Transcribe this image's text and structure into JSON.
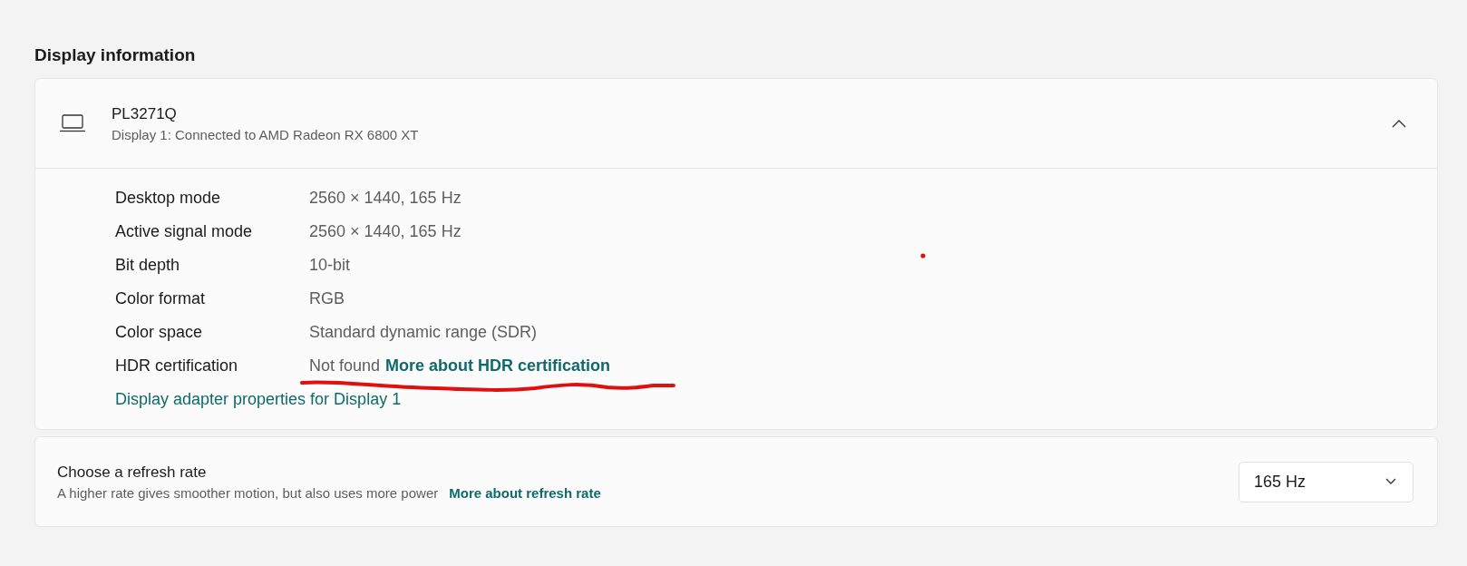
{
  "section_title": "Display information",
  "display": {
    "name": "PL3271Q",
    "subtitle": "Display 1: Connected to AMD Radeon RX 6800 XT",
    "expanded": true,
    "details": [
      {
        "label": "Desktop mode",
        "value": "2560 × 1440, 165 Hz"
      },
      {
        "label": "Active signal mode",
        "value": "2560 × 1440, 165 Hz"
      },
      {
        "label": "Bit depth",
        "value": "10-bit"
      },
      {
        "label": "Color format",
        "value": "RGB"
      },
      {
        "label": "Color space",
        "value": "Standard dynamic range (SDR)"
      },
      {
        "label": "HDR certification",
        "value": "Not found",
        "link": "More about HDR certification"
      }
    ],
    "adapter_link": "Display adapter properties for Display 1"
  },
  "refresh": {
    "title": "Choose a refresh rate",
    "description": "A higher rate gives smoother motion, but also uses more power",
    "link": "More about refresh rate",
    "value": "165 Hz"
  }
}
